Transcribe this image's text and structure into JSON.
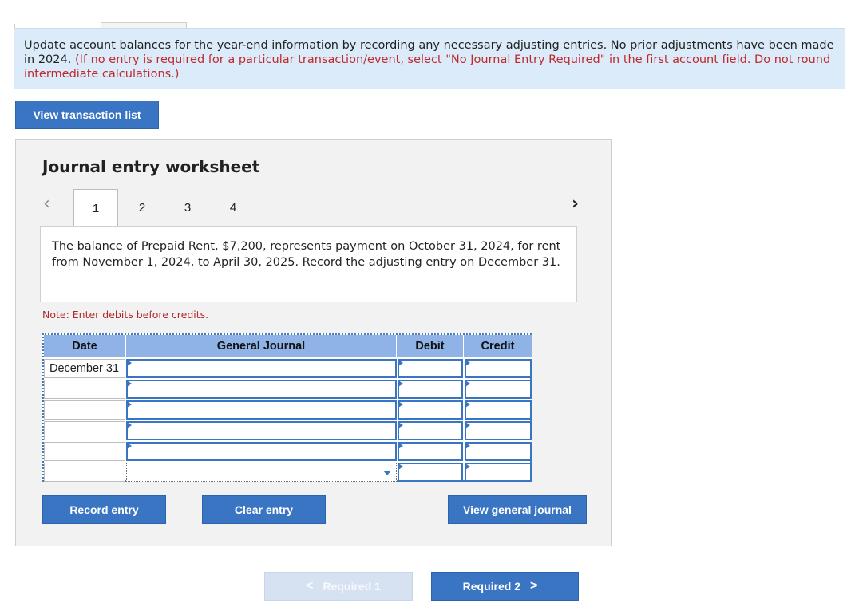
{
  "instructions": {
    "text": "Update account balances for the year-end information by recording any necessary adjusting entries. No prior adjustments have been made in 2024.",
    "note": "(If no entry is required for a particular transaction/event, select \"No Journal Entry Required\" in the first account field. Do not round intermediate calculations.)"
  },
  "buttons": {
    "view_transaction_list": "View transaction list",
    "record_entry": "Record entry",
    "clear_entry": "Clear entry",
    "view_general_journal": "View general journal"
  },
  "worksheet": {
    "title": "Journal entry worksheet",
    "prev_icon": "‹",
    "next_icon": "›",
    "tabs": [
      "1",
      "2",
      "3",
      "4"
    ],
    "active_tab": "1",
    "description": "The balance of Prepaid Rent, $7,200, represents payment on October 31, 2024, for rent from November 1, 2024, to April 30, 2025. Record the adjusting entry on December 31.",
    "note": "Note: Enter debits before credits.",
    "columns": [
      "Date",
      "General Journal",
      "Debit",
      "Credit"
    ],
    "rows": [
      {
        "date": "December 31",
        "account": "",
        "debit": "",
        "credit": ""
      },
      {
        "date": "",
        "account": "",
        "debit": "",
        "credit": ""
      },
      {
        "date": "",
        "account": "",
        "debit": "",
        "credit": ""
      },
      {
        "date": "",
        "account": "",
        "debit": "",
        "credit": ""
      },
      {
        "date": "",
        "account": "",
        "debit": "",
        "credit": ""
      },
      {
        "date": "",
        "account": "",
        "debit": "",
        "credit": ""
      }
    ]
  },
  "footer": {
    "required1": "Required 1",
    "required2": "Required 2",
    "left_chevron": "<",
    "right_chevron": ">"
  },
  "colors": {
    "accent": "#3a75c4",
    "instructions_bg": "#dcebf9",
    "note_red": "#c0282b",
    "header_blue": "#8fb3e6"
  }
}
